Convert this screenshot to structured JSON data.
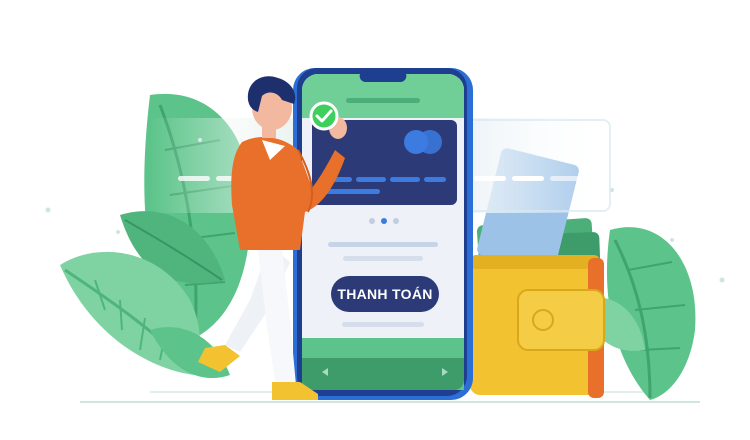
{
  "payment_screen": {
    "pay_button_label": "THANH TOÁN",
    "carousel": {
      "dot_count": 3,
      "active_index": 1
    }
  },
  "colors": {
    "phone_frame": "#2b6fd6",
    "phone_screen_header": "#6fcf97",
    "card": "#2c3a78",
    "card_logo": "#3c7be0",
    "pay_button": "#2c3a78",
    "leaves": "#5cc48a",
    "wallet": "#f2c230",
    "wallet_strap": "#e8702a",
    "shirt": "#e8702a"
  },
  "icons": [
    "check-icon",
    "card-logo-icon",
    "prev-arrow-icon",
    "next-arrow-icon"
  ]
}
